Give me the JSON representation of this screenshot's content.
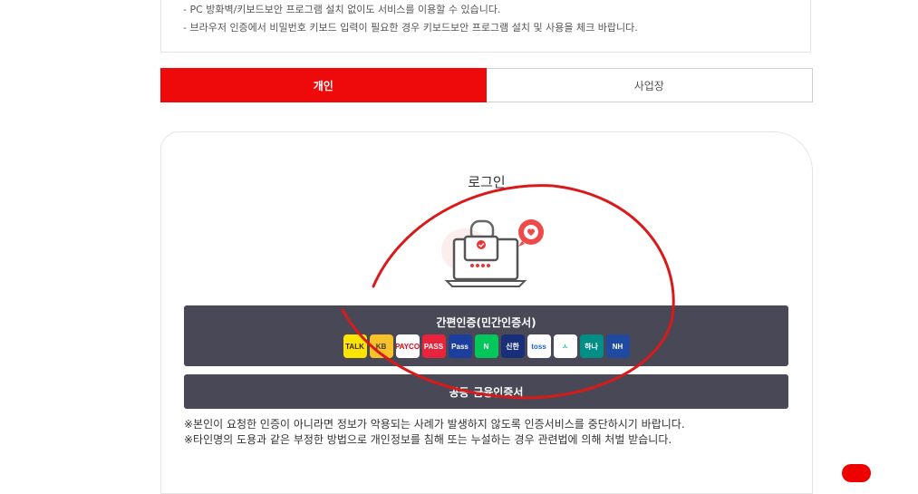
{
  "notice": {
    "lines": [
      "- PC 방화벽/키보드보안 프로그램 설치 없이도 서비스를 이용할 수 있습니다.",
      "- 브라우저 인증에서 비밀번호 키보드 입력이 필요한 경우 키보드보안 프로그램 설치 및 사용을 체크 바랍니다."
    ]
  },
  "tabs": {
    "personal": "개인",
    "business": "사업장"
  },
  "login": {
    "title": "로그인",
    "simple_auth_label": "간편인증(민간인증서)",
    "cert_label": "공동·금융인증서",
    "providers": [
      {
        "name": "kakao-icon",
        "text": "TALK",
        "bg": "#fee500",
        "fg": "#3c1e1e"
      },
      {
        "name": "kb-icon",
        "text": "KB",
        "bg": "#f6c12a",
        "fg": "#4a3a20"
      },
      {
        "name": "payco-icon",
        "text": "PAYCO",
        "bg": "#ffffff",
        "fg": "#e60012"
      },
      {
        "name": "pass-icon",
        "text": "PASS",
        "bg": "#e8243c",
        "fg": "#ffffff"
      },
      {
        "name": "samsung-pass-icon",
        "text": "Pass",
        "bg": "#1c3e9f",
        "fg": "#ffffff"
      },
      {
        "name": "naver-icon",
        "text": "N",
        "bg": "#03c75a",
        "fg": "#ffffff"
      },
      {
        "name": "shinhan-icon",
        "text": "신한",
        "bg": "#1a2f7a",
        "fg": "#ffffff"
      },
      {
        "name": "toss-icon",
        "text": "toss",
        "bg": "#ffffff",
        "fg": "#1b64da"
      },
      {
        "name": "banksalad-icon",
        "text": "ㅅ",
        "bg": "#ffffff",
        "fg": "#1fc08e"
      },
      {
        "name": "hana-icon",
        "text": "하나",
        "bg": "#008e87",
        "fg": "#ffffff"
      },
      {
        "name": "nh-icon",
        "text": "NH",
        "bg": "#1f4aa0",
        "fg": "#ffffff"
      }
    ]
  },
  "warnings": [
    "※본인이 요청한 인증이 아니라면 정보가 악용되는 사례가 발생하지 않도록 인증서비스를 중단하시기 바랍니다.",
    "※타인명의 도용과 같은 부정한 방법으로 개인정보를 침해 또는 누설하는 경우 관련법에 의해 처벌 받습니다."
  ],
  "colors": {
    "accent": "#ee0a0a",
    "button_dark": "#484857",
    "annotation": "#d91a1a"
  }
}
